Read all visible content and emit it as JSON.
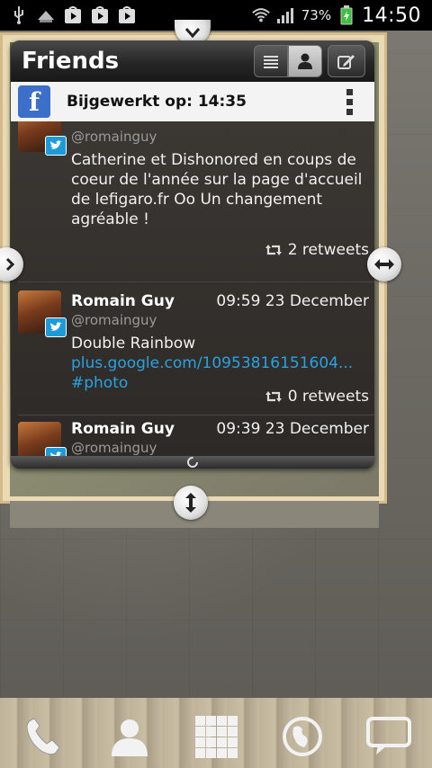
{
  "statusbar": {
    "icons": [
      "usb-icon",
      "upload-icon",
      "play-store-icon",
      "play-store-icon",
      "play-store-icon",
      "wifi-icon",
      "signal-icon",
      "battery-icon"
    ],
    "battery_pct": "73%",
    "clock": "14:50"
  },
  "widget": {
    "title": "Friends",
    "updated_label": "Bijgewerkt op: 14:35",
    "tweets": [
      {
        "handle": "@romainguy",
        "text": "Catherine et Dishonored en coups de coeur de l'année sur la page d'accueil de lefigaro.fr Oo Un changement agréable !",
        "retweets": "2 retweets"
      },
      {
        "name": "Romain Guy",
        "time": "09:59 23 December",
        "handle": "@romainguy",
        "text_plain": "Double Rainbow ",
        "text_link": "plus.google.com/10953816151604... #photo",
        "retweets": "0 retweets"
      },
      {
        "name": "Romain Guy",
        "time": "09:39 23 December",
        "handle": "@romainguy"
      }
    ]
  },
  "dock": [
    "phone-icon",
    "contacts-icon",
    "apps-grid-icon",
    "browser-icon",
    "messaging-icon"
  ],
  "colors": {
    "twitter_blue": "#1d9bd8",
    "link_blue": "#27a3e3",
    "facebook_blue": "#3b6fc9"
  }
}
